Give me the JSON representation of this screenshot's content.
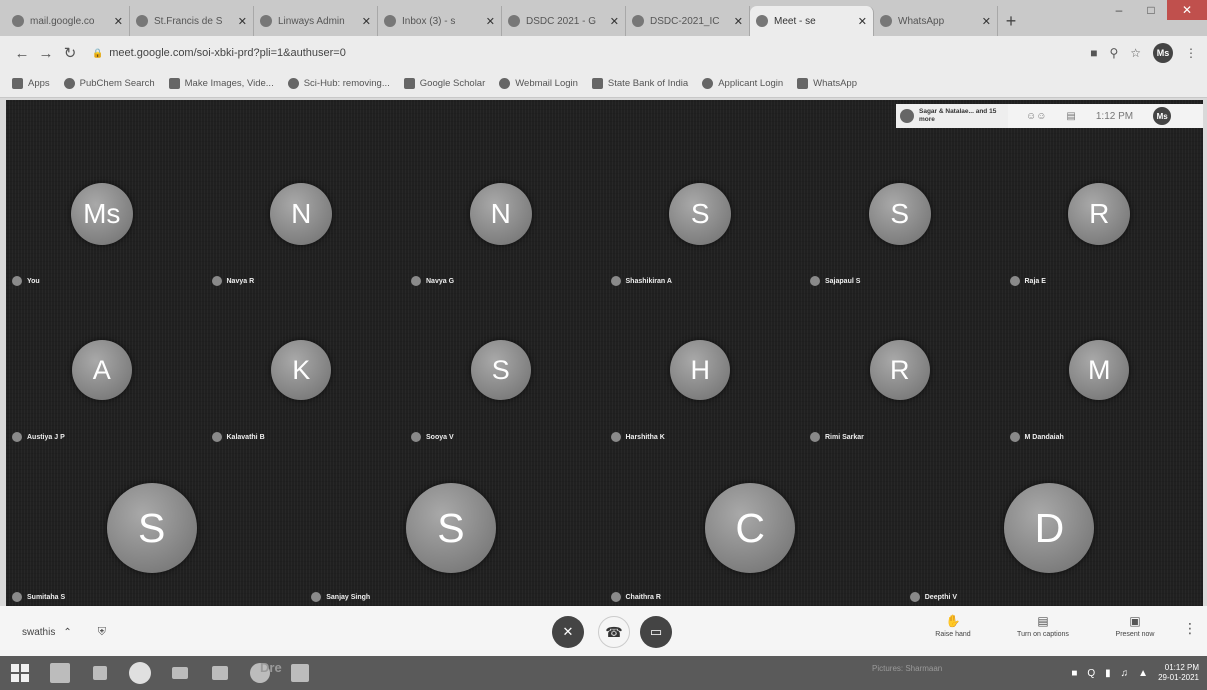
{
  "browser": {
    "tabs": [
      {
        "title": "mail.google.co",
        "active": false
      },
      {
        "title": "St.Francis de S",
        "active": false
      },
      {
        "title": "Linways Admin",
        "active": false
      },
      {
        "title": "Inbox (3) - s",
        "active": false
      },
      {
        "title": "DSDC 2021 - G",
        "active": false
      },
      {
        "title": "DSDC-2021_IC",
        "active": false
      },
      {
        "title": "Meet - se",
        "active": true
      },
      {
        "title": "WhatsApp",
        "active": false
      }
    ],
    "url": "meet.google.com/soi-xbki-prd?pli=1&authuser=0",
    "profile_initials": "Ms",
    "bookmarks": [
      {
        "label": "Apps",
        "icon": "apps-grid-icon"
      },
      {
        "label": "PubChem Search",
        "icon": "pubchem-icon"
      },
      {
        "label": "Make Images, Vide...",
        "icon": "make-images-icon"
      },
      {
        "label": "Sci-Hub: removing...",
        "icon": "scihub-icon"
      },
      {
        "label": "Google Scholar",
        "icon": "scholar-icon"
      },
      {
        "label": "Webmail Login",
        "icon": "webmail-icon"
      },
      {
        "label": "State Bank of India",
        "icon": "sbi-icon"
      },
      {
        "label": "Applicant Login",
        "icon": "applicant-icon"
      },
      {
        "label": "WhatsApp",
        "icon": "whatsapp-icon"
      }
    ]
  },
  "meet": {
    "participants_summary": "Sagar & Natalae... and 15 more",
    "time": "1:12 PM",
    "self_initials": "Ms",
    "participants": [
      {
        "initials": "Ms",
        "name": "You"
      },
      {
        "initials": "N",
        "name": "Navya R"
      },
      {
        "initials": "N",
        "name": "Navya G"
      },
      {
        "initials": "S",
        "name": "Shashikiran A"
      },
      {
        "initials": "S",
        "name": "Sajapaul S"
      },
      {
        "initials": "R",
        "name": "Raja E"
      },
      {
        "initials": "A",
        "name": "Austiya J P"
      },
      {
        "initials": "K",
        "name": "Kalavathi B"
      },
      {
        "initials": "S",
        "name": "Sooya V"
      },
      {
        "initials": "H",
        "name": "Harshitha K"
      },
      {
        "initials": "R",
        "name": "Rimi Sarkar"
      },
      {
        "initials": "M",
        "name": "M Dandaiah"
      },
      {
        "initials": "S",
        "name": "Sumitaha S"
      },
      {
        "initials": "S",
        "name": "Sanjay Singh"
      },
      {
        "initials": "C",
        "name": "Chaithra R"
      },
      {
        "initials": "D",
        "name": "Deepthi V"
      }
    ],
    "meeting_name": "swathis",
    "controls": {
      "raise_hand": "Raise hand",
      "captions": "Turn on captions",
      "present": "Present now"
    }
  },
  "taskbar": {
    "clock_time": "01:12 PM",
    "clock_date": "29-01-2021",
    "ghost_text": "Dre",
    "faded_text": "Pictures: Sharmaan"
  }
}
